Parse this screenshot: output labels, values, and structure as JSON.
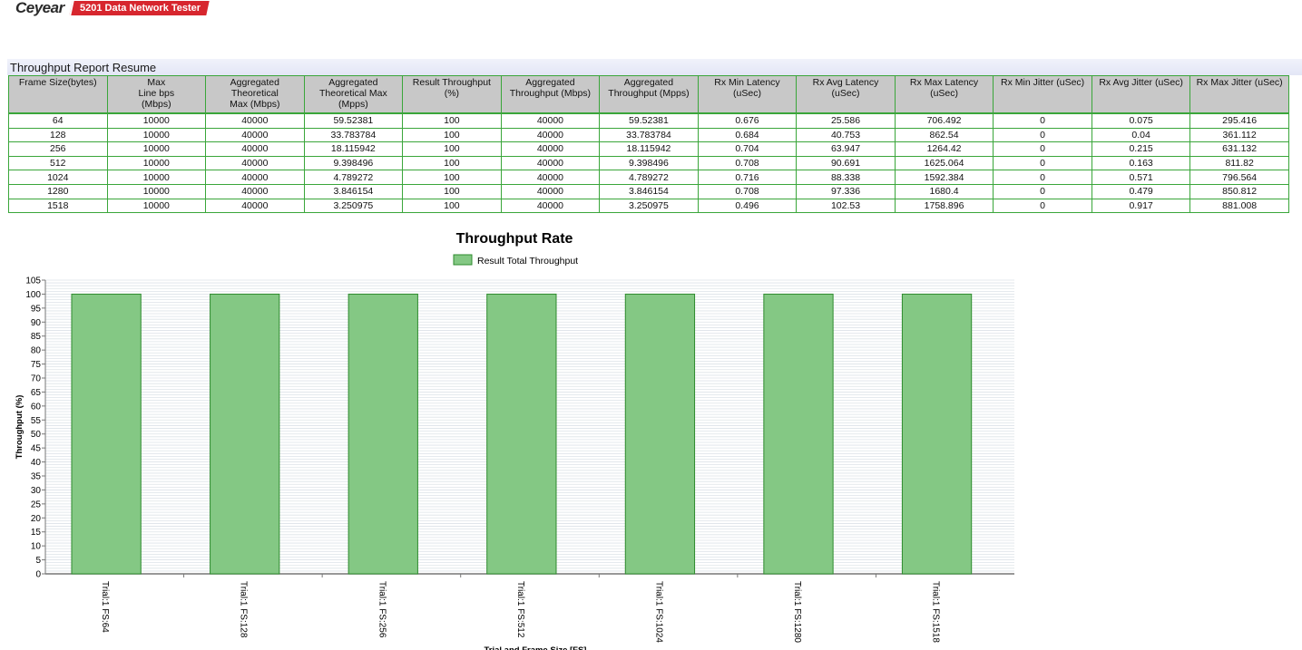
{
  "header": {
    "brand": "Ceyear",
    "product": "5201 Data Network Tester"
  },
  "report": {
    "title": "Throughput Report Resume",
    "columns": [
      [
        "Frame Size(bytes)"
      ],
      [
        "Max",
        "Line bps",
        "(Mbps)"
      ],
      [
        "Aggregated",
        "Theoretical",
        "Max (Mbps)"
      ],
      [
        "Aggregated",
        "Theoretical Max",
        "(Mpps)"
      ],
      [
        "Result Throughput (%)"
      ],
      [
        "Aggregated",
        "Throughput (Mbps)"
      ],
      [
        "Aggregated",
        "Throughput (Mpps)"
      ],
      [
        "Rx Min Latency",
        "(uSec)"
      ],
      [
        "Rx Avg Latency",
        "(uSec)"
      ],
      [
        "Rx Max Latency",
        "(uSec)"
      ],
      [
        "Rx Min Jitter (uSec)"
      ],
      [
        "Rx Avg Jitter (uSec)"
      ],
      [
        "Rx Max Jitter (uSec)"
      ]
    ],
    "rows": [
      [
        "64",
        "10000",
        "40000",
        "59.52381",
        "100",
        "40000",
        "59.52381",
        "0.676",
        "25.586",
        "706.492",
        "0",
        "0.075",
        "295.416"
      ],
      [
        "128",
        "10000",
        "40000",
        "33.783784",
        "100",
        "40000",
        "33.783784",
        "0.684",
        "40.753",
        "862.54",
        "0",
        "0.04",
        "361.112"
      ],
      [
        "256",
        "10000",
        "40000",
        "18.115942",
        "100",
        "40000",
        "18.115942",
        "0.704",
        "63.947",
        "1264.42",
        "0",
        "0.215",
        "631.132"
      ],
      [
        "512",
        "10000",
        "40000",
        "9.398496",
        "100",
        "40000",
        "9.398496",
        "0.708",
        "90.691",
        "1625.064",
        "0",
        "0.163",
        "811.82"
      ],
      [
        "1024",
        "10000",
        "40000",
        "4.789272",
        "100",
        "40000",
        "4.789272",
        "0.716",
        "88.338",
        "1592.384",
        "0",
        "0.571",
        "796.564"
      ],
      [
        "1280",
        "10000",
        "40000",
        "3.846154",
        "100",
        "40000",
        "3.846154",
        "0.708",
        "97.336",
        "1680.4",
        "0",
        "0.479",
        "850.812"
      ],
      [
        "1518",
        "10000",
        "40000",
        "3.250975",
        "100",
        "40000",
        "3.250975",
        "0.496",
        "102.53",
        "1758.896",
        "0",
        "0.917",
        "881.008"
      ]
    ]
  },
  "colors": {
    "bar_fill": "#84c884",
    "bar_stroke": "#2e8b2e",
    "table_border": "#3aa63a",
    "header_bg": "#c8c8c8",
    "badge_red": "#d7262e"
  },
  "chart_data": {
    "type": "bar",
    "title": "Throughput Rate",
    "ylabel": "Throughput (%)",
    "xlabel": "Trial and Frame Size [FS]",
    "ylim": [
      0,
      105
    ],
    "ytick_step": 5,
    "legend_position": "top",
    "grid": true,
    "categories": [
      "Trial:1 FS:64",
      "Trial:1 FS:128",
      "Trial:1 FS:256",
      "Trial:1 FS:512",
      "Trial:1 FS:1024",
      "Trial:1 FS:1280",
      "Trial:1 FS:1518"
    ],
    "series": [
      {
        "name": "Result Total Throughput",
        "values": [
          100,
          100,
          100,
          100,
          100,
          100,
          100
        ]
      }
    ]
  }
}
